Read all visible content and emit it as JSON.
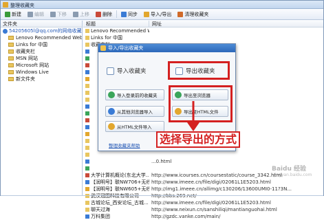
{
  "window": {
    "title": "整理收藏夹"
  },
  "toolbar": {
    "items": [
      {
        "label": "新建",
        "color": "#3a9b3a",
        "enabled": true
      },
      {
        "label": "编辑",
        "color": "#8a9bb0",
        "enabled": false
      },
      {
        "label": "下移",
        "color": "#8a9bb0",
        "enabled": false
      },
      {
        "label": "上移",
        "color": "#8a9bb0",
        "enabled": false
      },
      {
        "label": "删除",
        "color": "#c94a3a",
        "enabled": true
      },
      {
        "label": "同步",
        "color": "#3a7bd5",
        "enabled": true
      },
      {
        "label": "导入/导出",
        "color": "#e2a72e",
        "enabled": true
      },
      {
        "label": "清理收藏夹",
        "color": "#d06a2a",
        "enabled": true
      }
    ]
  },
  "left_pane": {
    "header": "文件夹",
    "root": "54205605l@qq.com的网络收藏夹",
    "folders": [
      "Lenovo Recommended Websites",
      "Links for 中国",
      "收藏夹栏",
      "MSN 网站",
      "Microsoft 网站",
      "Windows Live",
      "新文件夹"
    ]
  },
  "right_pane": {
    "headers": [
      "标题",
      "网址"
    ],
    "rows": [
      {
        "name": "Lenovo Recommended Web...",
        "url": ""
      },
      {
        "name": "Links for 中国",
        "url": ""
      },
      {
        "name": "收藏夹栏",
        "url": ""
      },
      {
        "name": "",
        "url": ""
      },
      {
        "name": "",
        "url": ""
      },
      {
        "name": "",
        "url": "...Post.aspx"
      },
      {
        "name": "",
        "url": ""
      },
      {
        "name": "",
        "url": "...3e0912a1522ef"
      },
      {
        "name": "",
        "url": ""
      },
      {
        "name": "",
        "url": ""
      },
      {
        "name": "",
        "url": ""
      },
      {
        "name": "",
        "url": ""
      },
      {
        "name": "",
        "url": ""
      },
      {
        "name": "",
        "url": ""
      },
      {
        "name": "",
        "url": ""
      },
      {
        "name": "",
        "url": ""
      },
      {
        "name": "",
        "url": "...p0.html"
      },
      {
        "name": "",
        "url": ""
      },
      {
        "name": "",
        "url": ""
      },
      {
        "name": "",
        "url": "...0.html"
      },
      {
        "name": "",
        "url": ""
      },
      {
        "name": "大学计算机概论(东北大学...",
        "url": "http://www.icourses.cn/coursestatic/course_3342.html"
      },
      {
        "name": "【润明号】联NW706+无线...",
        "url": "http://www.imeee.cn/file/digi/02061L1E5203.html"
      },
      {
        "name": "【润明号】联NW605+无线...",
        "url": "http://img1.imeee.cn/allimg/c130206/13600UMI0-11?3N..."
      },
      {
        "name": "武汉冠图科技有限公司",
        "url": "http://bbs.269.net/"
      },
      {
        "name": "古城论坛_西安论坛_古城...",
        "url": "http://www.imeee.cn/file/digi/02061L1E5203.html"
      },
      {
        "name": "聊天过海",
        "url": "http://www.neixun.cn/sanshiliqi/mantianguohai.html"
      },
      {
        "name": "万科集团",
        "url": "http://gzdc.vanke.com/main/"
      }
    ]
  },
  "dialog": {
    "title": "导入/导出收藏夹",
    "import_heading": "导入收藏夹",
    "export_heading": "导出收藏夹",
    "buttons": {
      "import_logged": "导入登录前的收藏夹",
      "import_other_browser": "从其他浏览器导入",
      "import_html": "从HTML文件导入",
      "export_browser": "导出至浏览器",
      "export_html": "导出至HTML文件"
    },
    "help_link": "整理收藏夹帮助"
  },
  "annotation": {
    "text": "选择导出的方式"
  },
  "watermark": {
    "text": "Baidu 经验",
    "sub": "jingyan.baidu.com"
  },
  "colors": {
    "highlight": "#d42020",
    "link": "#2458b5",
    "title_bar": "#2c67b9"
  }
}
